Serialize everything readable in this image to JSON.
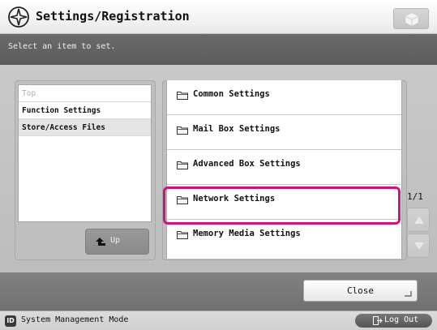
{
  "header": {
    "title": "Settings/Registration",
    "title_icon": "settings-gear-icon",
    "right_button_icon": "cube-icon"
  },
  "instruction": "Select an item to set.",
  "tree": {
    "items": [
      {
        "label": "Top",
        "state": "inactive"
      },
      {
        "label": "Function Settings",
        "state": "normal"
      },
      {
        "label": "Store/Access Files",
        "state": "selected"
      }
    ],
    "up_label": "Up"
  },
  "list": {
    "items": [
      {
        "label": "Common Settings",
        "icon": "folder-icon"
      },
      {
        "label": "Mail Box Settings",
        "icon": "folder-icon"
      },
      {
        "label": "Advanced Box Settings",
        "icon": "folder-icon"
      },
      {
        "label": "Network Settings",
        "icon": "folder-icon",
        "highlighted": true
      },
      {
        "label": "Memory Media Settings",
        "icon": "folder-icon"
      }
    ],
    "page_indicator": "1/1",
    "highlight_color": "#d4107a"
  },
  "footer": {
    "close_label": "Close"
  },
  "status": {
    "id_badge": "ID",
    "mode": "System Management Mode",
    "logout_label": "Log Out"
  }
}
